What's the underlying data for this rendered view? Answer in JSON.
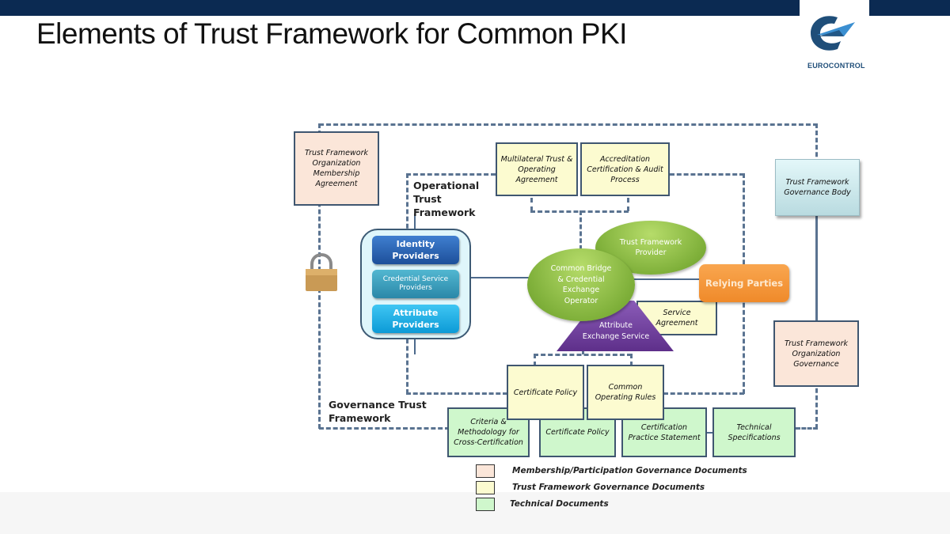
{
  "slide": {
    "title": "Elements of Trust Framework for Common PKI",
    "logo_text": "EUROCONTROL",
    "logo_icon": "eurocontrol-logo-icon"
  },
  "colors": {
    "header_bar": "#0b2a52",
    "membership_docs": "#fbe6d9",
    "trust_framework_docs": "#fcfbd0",
    "technical_docs": "#cff7cc",
    "identity_providers": "#2a62b5",
    "credential_service_providers": "#3aa0bf",
    "attribute_providers": "#1cb0e6",
    "ellipse_green": "#8dbd45",
    "relying_parties": "#f39637",
    "attribute_exchange": "#6e3d98"
  },
  "frames": {
    "operational": "Operational\nTrust Framework",
    "governance": "Governance Trust\nFramework"
  },
  "boxes": {
    "membership_agreement": "Trust Framework Organization Membership Agreement",
    "multilateral_agreement": "Multilateral Trust & Operating Agreement",
    "accreditation": "Accreditation Certification & Audit Process",
    "governance_body": "Trust Framework Governance Body",
    "organization_governance": "Trust Framework Organization Governance",
    "service_agreement": "Service Agreement",
    "certificate_policy_top": "Certificate Policy",
    "common_operating_rules": "Common Operating Rules",
    "criteria_methodology": "Criteria & Methodology for Cross-Certification",
    "certificate_policy_bottom": "Certificate Policy",
    "certification_practice": "Certification Practice Statement",
    "technical_specifications": "Technical Specifications"
  },
  "providers": {
    "identity": "Identity Providers",
    "credential_service": "Credential Service Providers",
    "attribute": "Attribute Providers"
  },
  "entities": {
    "trust_framework_provider": "Trust Framework Provider",
    "common_bridge": "Common Bridge & Credential Exchange Operator",
    "relying_parties": "Relying Parties",
    "attribute_exchange_service": "Attribute Exchange Service"
  },
  "legend": [
    {
      "label": "Membership/Participation Governance Documents",
      "color": "#fbe6d9"
    },
    {
      "label": "Trust Framework Governance Documents",
      "color": "#fcfbd0"
    },
    {
      "label": "Technical Documents",
      "color": "#cff7cc"
    }
  ]
}
